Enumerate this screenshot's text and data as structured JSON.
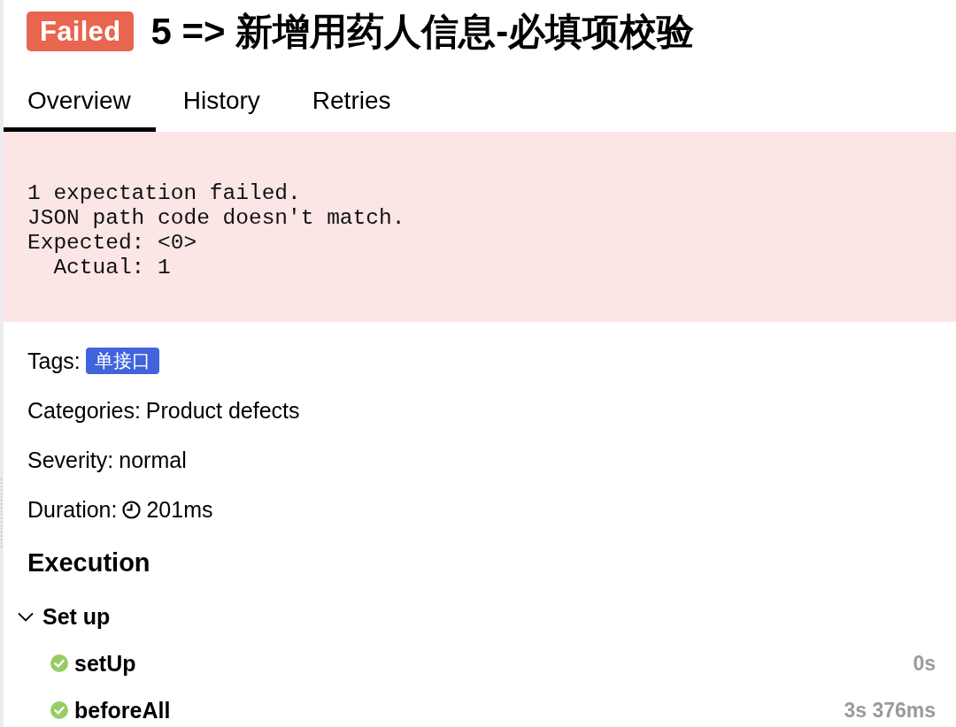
{
  "header": {
    "status": {
      "kind": "failed",
      "label": "Failed"
    },
    "title": "5 => 新增用药人信息-必填项校验"
  },
  "tabs": [
    {
      "label": "Overview",
      "selected": true
    },
    {
      "label": "History",
      "selected": false
    },
    {
      "label": "Retries",
      "selected": false
    }
  ],
  "error_message": "1 expectation failed.\nJSON path code doesn't match.\nExpected: <0>\n  Actual: 1",
  "details": [
    {
      "kind": "tags",
      "label": "Tags:",
      "tags": [
        "单接口"
      ]
    },
    {
      "kind": "text",
      "label": "Categories:",
      "value": "Product defects"
    },
    {
      "kind": "text",
      "label": "Severity:",
      "value": "normal"
    },
    {
      "kind": "duration",
      "label": "Duration:",
      "value": "201ms"
    }
  ],
  "execution": {
    "title": "Execution",
    "sections": [
      {
        "title": "Set up",
        "expanded": true,
        "steps": [
          {
            "kind": "passed",
            "name": "setUp",
            "duration": "0s"
          },
          {
            "kind": "passed",
            "name": "beforeAll",
            "duration": "3s 376ms"
          }
        ]
      }
    ]
  }
}
